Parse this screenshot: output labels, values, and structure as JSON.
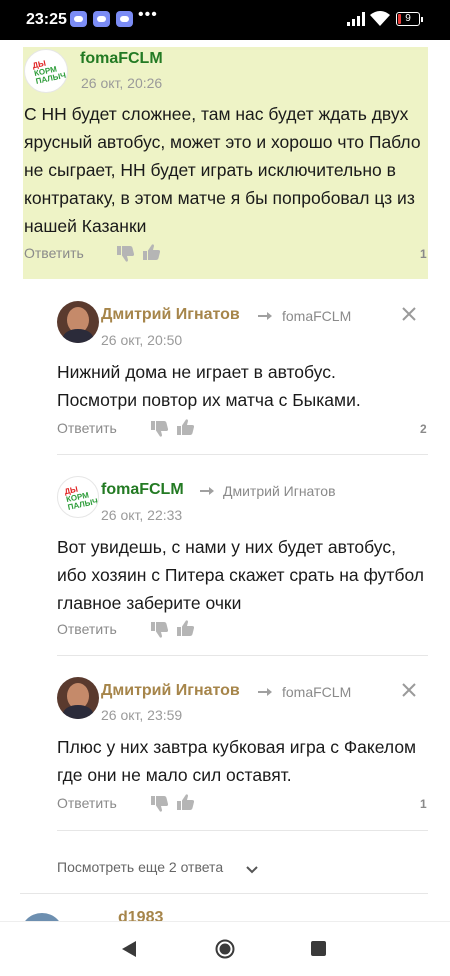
{
  "status_bar": {
    "time": "23:25",
    "battery": "9"
  },
  "comments": [
    {
      "author": "fomaFCLM",
      "date": "26 окт, 20:26",
      "text": "С НН будет сложнее, там нас будет ждать двух ярусный автобус, может это и хорошо что Пабло не сыграет, НН будет играть исключительно в контратаку, в этом матче я бы попробовал цз из нашей Казанки",
      "answer_label": "Ответить",
      "score": "1",
      "avatar_text": [
        "ДЫ",
        "КОРМ",
        "ПАЛЫЧ"
      ]
    },
    {
      "author": "Дмитрий Игнатов",
      "reply_to": "fomaFCLM",
      "date": "26 окт, 20:50",
      "text": "Нижний дома не играет в автобус. Посмотри повтор их матча с Быками.",
      "answer_label": "Ответить",
      "score": "2"
    },
    {
      "author": "fomaFCLM",
      "reply_to": "Дмитрий Игнатов",
      "date": "26 окт, 22:33",
      "text": "Вот увидешь, с нами у них будет автобус, ибо хозяин с Питера скажет срать на футбол главное заберите очки",
      "answer_label": "Ответить",
      "avatar_text": [
        "ДЫ",
        "КОРМ",
        "ПАЛЫЧ"
      ]
    },
    {
      "author": "Дмитрий Игнатов",
      "reply_to": "fomaFCLM",
      "date": "26 окт, 23:59",
      "text": "Плюс у них завтра кубковая игра с Факелом где они не мало сил оставят.",
      "answer_label": "Ответить",
      "score": "1"
    }
  ],
  "more_replies": "Посмотреть еще 2 ответа",
  "partial_next_author": "d1983",
  "colors": {
    "highlight": "#eef3c6",
    "author_green": "#237a23",
    "author_gold": "#a6854a"
  },
  "icons": [
    "thumb-down-icon",
    "thumb-up-icon",
    "reply-arrow-icon",
    "close-icon",
    "chevron-down-icon",
    "back-icon",
    "home-icon",
    "recents-icon"
  ]
}
